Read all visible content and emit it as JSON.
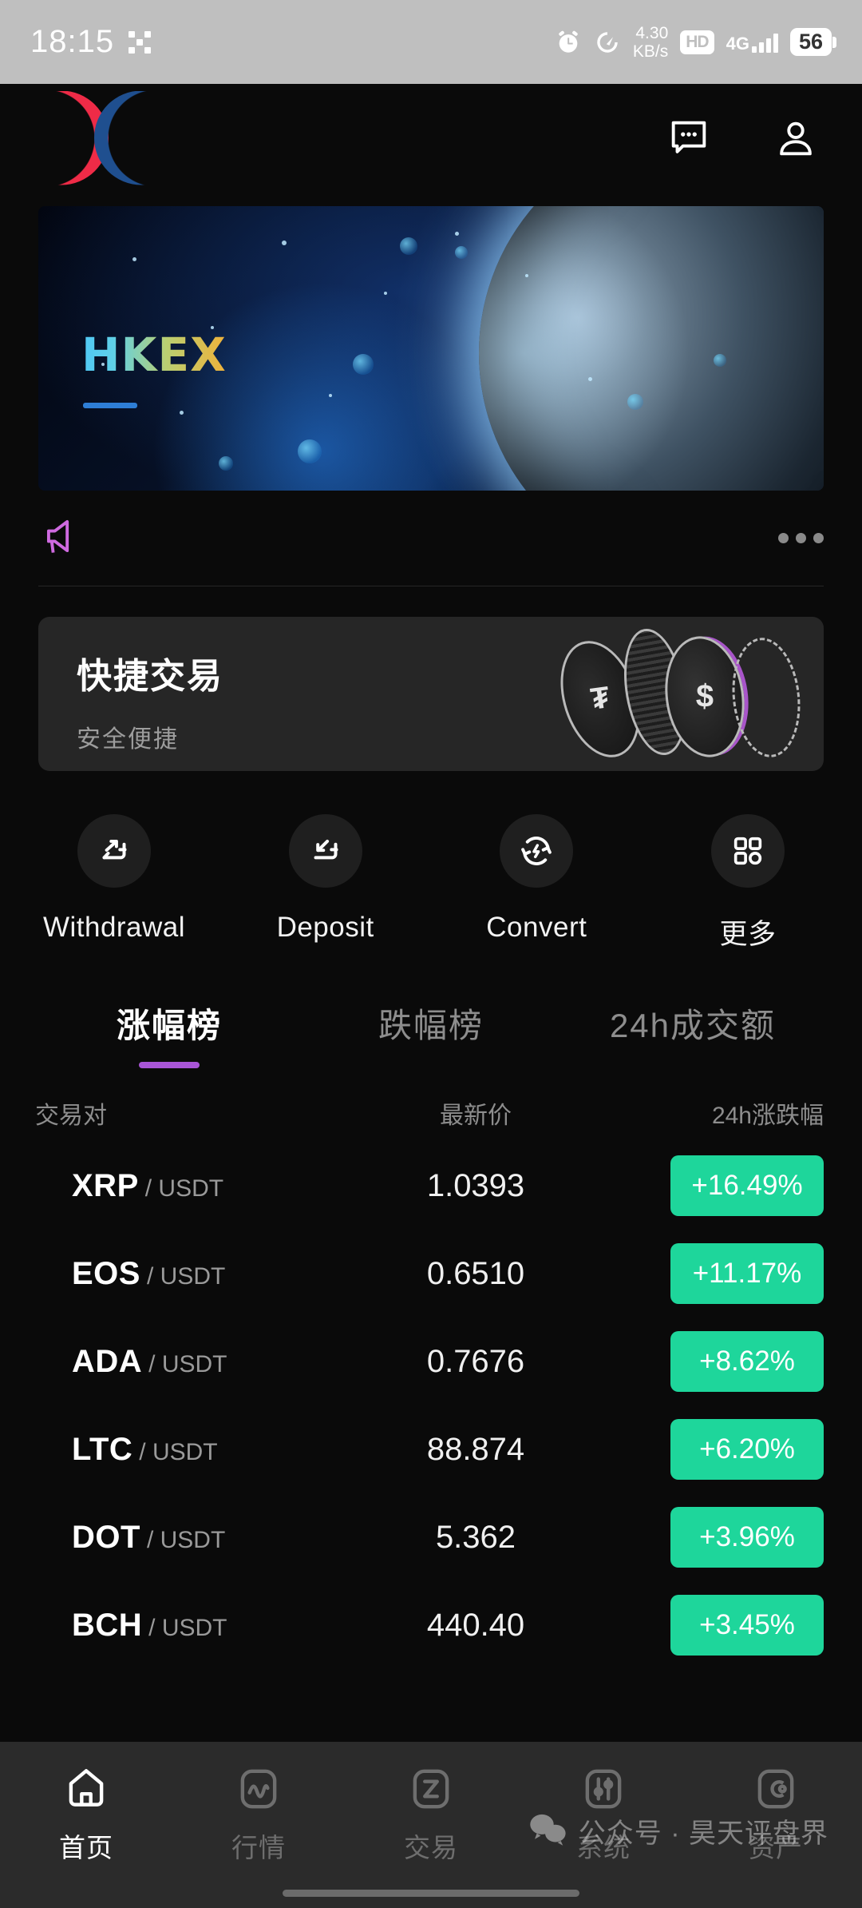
{
  "status_bar": {
    "time": "18:15",
    "net_speed": "4.30",
    "net_speed_unit": "KB/s",
    "hd_label": "HD",
    "network": "4G",
    "battery": "56"
  },
  "header": {
    "logo_alt": "DC",
    "chat_icon": "chat-bubble-icon",
    "profile_icon": "user-icon"
  },
  "banner": {
    "title": "HKEX"
  },
  "announcement": {
    "megaphone_icon": "megaphone-icon",
    "more_icon": "more-dots-icon",
    "text": ""
  },
  "quick_trade": {
    "title": "快捷交易",
    "subtitle": "安全便捷",
    "coin_usdt": "₮",
    "coin_dollar": "$"
  },
  "actions": [
    {
      "label": "Withdrawal",
      "icon": "withdraw-icon"
    },
    {
      "label": "Deposit",
      "icon": "deposit-icon"
    },
    {
      "label": "Convert",
      "icon": "convert-icon"
    },
    {
      "label": "更多",
      "icon": "grid-more-icon"
    }
  ],
  "tabs": [
    {
      "label": "涨幅榜",
      "active": true
    },
    {
      "label": "跌幅榜",
      "active": false
    },
    {
      "label": "24h成交额",
      "active": false
    }
  ],
  "market_table": {
    "columns": [
      "交易对",
      "最新价",
      "24h涨跌幅"
    ],
    "rows": [
      {
        "symbol": "XRP",
        "quote": "/ USDT",
        "price": "1.0393",
        "change": "+16.49%"
      },
      {
        "symbol": "EOS",
        "quote": "/ USDT",
        "price": "0.6510",
        "change": "+11.17%"
      },
      {
        "symbol": "ADA",
        "quote": "/ USDT",
        "price": "0.7676",
        "change": "+8.62%"
      },
      {
        "symbol": "LTC",
        "quote": "/ USDT",
        "price": "88.874",
        "change": "+6.20%"
      },
      {
        "symbol": "DOT",
        "quote": "/ USDT",
        "price": "5.362",
        "change": "+3.96%"
      },
      {
        "symbol": "BCH",
        "quote": "/ USDT",
        "price": "440.40",
        "change": "+3.45%"
      }
    ]
  },
  "bottom_nav": [
    {
      "label": "首页",
      "icon": "home-icon",
      "active": true
    },
    {
      "label": "行情",
      "icon": "chart-icon",
      "active": false
    },
    {
      "label": "交易",
      "icon": "trade-icon",
      "active": false
    },
    {
      "label": "系统",
      "icon": "system-icon",
      "active": false
    },
    {
      "label": "资产",
      "icon": "assets-icon",
      "active": false
    }
  ],
  "watermark": {
    "text": "公众号 · 昊天评盘界",
    "icon": "wechat-icon"
  },
  "colors": {
    "positive": "#1ed69b",
    "accent": "#a855d6",
    "logo_red": "#ef2b47",
    "logo_blue": "#1f4f8f",
    "status_bar_bg": "#bfbfbf",
    "nav_bg": "#2b2b2b"
  }
}
